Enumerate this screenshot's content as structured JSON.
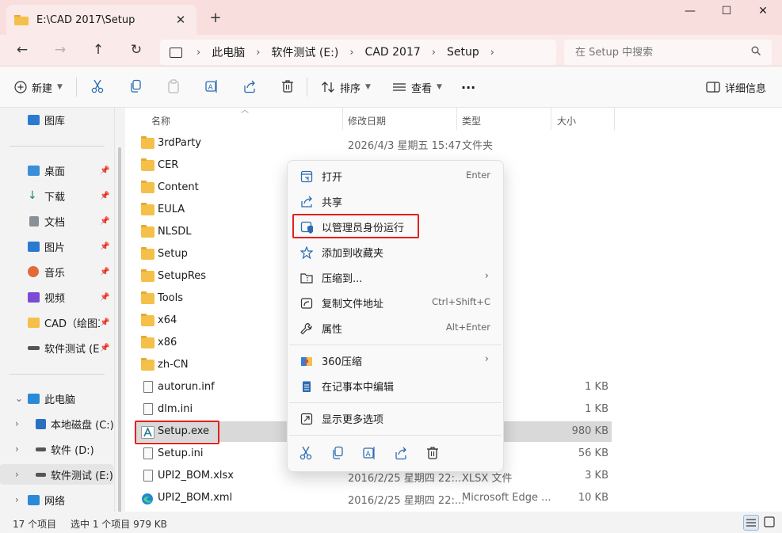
{
  "window": {
    "tab_title": "E:\\CAD 2017\\Setup",
    "tab_close": "✕",
    "new_tab": "+",
    "minimize": "—",
    "maximize": "☐",
    "close": "✕"
  },
  "nav": {
    "back": "←",
    "forward": "→",
    "up": "↑",
    "refresh": "↻",
    "breadcrumb": [
      "此电脑",
      "软件测试 (E:)",
      "CAD 2017",
      "Setup"
    ],
    "search_placeholder": "在 Setup 中搜索"
  },
  "toolbar": {
    "new_label": "新建",
    "sort_label": "排序",
    "view_label": "查看",
    "more_label": "···",
    "details_label": "详细信息"
  },
  "sidebar": {
    "top_item": "图库",
    "quick_access": [
      {
        "label": "桌面",
        "icon": "desktop-icon"
      },
      {
        "label": "下载",
        "icon": "download-icon"
      },
      {
        "label": "文档",
        "icon": "document-icon"
      },
      {
        "label": "图片",
        "icon": "pictures-icon"
      },
      {
        "label": "音乐",
        "icon": "music-icon"
      },
      {
        "label": "视频",
        "icon": "video-icon"
      },
      {
        "label": "CAD（绘图工",
        "icon": "folder-icon"
      },
      {
        "label": "软件测试 (E:)",
        "icon": "drive-icon"
      }
    ],
    "this_pc": "此电脑",
    "drives": [
      "本地磁盘 (C:)",
      "软件 (D:)",
      "软件测试 (E:)"
    ],
    "network": "网络"
  },
  "columns": {
    "name": "名称",
    "modified": "修改日期",
    "type": "类型",
    "size": "大小"
  },
  "files": [
    {
      "name": "3rdParty",
      "date": "2026/4/3 星期五 15:47",
      "type": "文件夹",
      "size": "",
      "kind": "folder"
    },
    {
      "name": "CER",
      "date": "",
      "type": "",
      "size": "",
      "kind": "folder"
    },
    {
      "name": "Content",
      "date": "",
      "type": "",
      "size": "",
      "kind": "folder"
    },
    {
      "name": "EULA",
      "date": "",
      "type": "",
      "size": "",
      "kind": "folder"
    },
    {
      "name": "NLSDL",
      "date": "",
      "type": "",
      "size": "",
      "kind": "folder"
    },
    {
      "name": "Setup",
      "date": "",
      "type": "",
      "size": "",
      "kind": "folder"
    },
    {
      "name": "SetupRes",
      "date": "",
      "type": "",
      "size": "",
      "kind": "folder"
    },
    {
      "name": "Tools",
      "date": "",
      "type": "",
      "size": "",
      "kind": "folder"
    },
    {
      "name": "x64",
      "date": "",
      "type": "",
      "size": "",
      "kind": "folder"
    },
    {
      "name": "x86",
      "date": "",
      "type": "",
      "size": "",
      "kind": "folder"
    },
    {
      "name": "zh-CN",
      "date": "",
      "type": "",
      "size": "",
      "kind": "folder"
    },
    {
      "name": "autorun.inf",
      "date": "",
      "type": "",
      "size": "1 KB",
      "kind": "file"
    },
    {
      "name": "dlm.ini",
      "date": "",
      "type": "",
      "size": "1 KB",
      "kind": "file"
    },
    {
      "name": "Setup.exe",
      "date": "",
      "type": "",
      "size": "980 KB",
      "kind": "exe"
    },
    {
      "name": "Setup.ini",
      "date": "",
      "type": "",
      "size": "56 KB",
      "kind": "file"
    },
    {
      "name": "UPI2_BOM.xlsx",
      "date": "2016/2/25 星期四 22:...",
      "type": "XLSX 文件",
      "size": "3 KB",
      "kind": "file"
    },
    {
      "name": "UPI2_BOM.xml",
      "date": "2016/2/25 星期四 22:...",
      "type": "Microsoft Edge ...",
      "size": "10 KB",
      "kind": "edge"
    }
  ],
  "context_menu": {
    "open": "打开",
    "open_key": "Enter",
    "share": "共享",
    "run_as_admin": "以管理员身份运行",
    "add_favorite": "添加到收藏夹",
    "compress_to": "压缩到...",
    "copy_path": "复制文件地址",
    "copy_path_key": "Ctrl+Shift+C",
    "properties": "属性",
    "properties_key": "Alt+Enter",
    "zip360": "360压缩",
    "edit_notepad": "在记事本中编辑",
    "more_options": "显示更多选项",
    "submenu_arrow": "›"
  },
  "status": {
    "item_count": "17 个项目",
    "selection": "选中 1 个项目  979 KB"
  },
  "colors": {
    "accent_red": "#e3211c",
    "folder": "#f5c04a",
    "titlebar": "#f9dede"
  }
}
